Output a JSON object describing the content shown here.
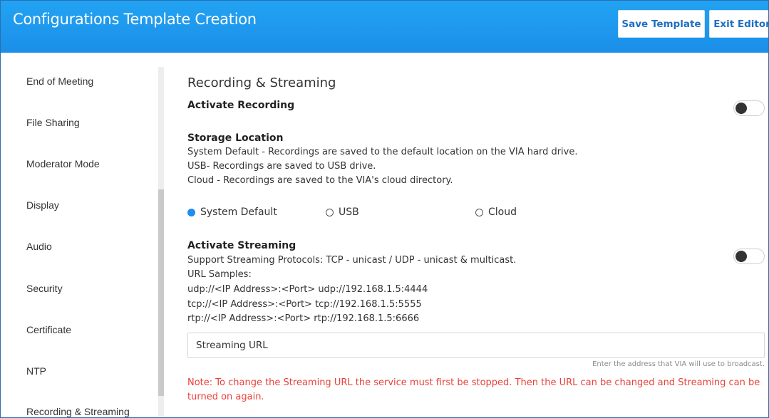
{
  "header": {
    "title": "Configurations Template Creation",
    "save_label": "Save Template",
    "exit_label": "Exit Editor"
  },
  "sidebar": {
    "items": [
      {
        "label": "End of Meeting"
      },
      {
        "label": "File Sharing"
      },
      {
        "label": "Moderator Mode"
      },
      {
        "label": "Display"
      },
      {
        "label": "Audio"
      },
      {
        "label": "Security"
      },
      {
        "label": "Certificate"
      },
      {
        "label": "NTP"
      },
      {
        "label": "Recording & Streaming"
      }
    ],
    "active_item": "Recording & Streaming"
  },
  "main": {
    "section_title": "Recording & Streaming",
    "recording": {
      "label": "Activate Recording",
      "enabled": false
    },
    "storage": {
      "title": "Storage Location",
      "lines": [
        "System Default - Recordings are saved to the default location on the VIA hard drive.",
        "USB- Recordings are saved to USB drive.",
        "Cloud - Recordings are saved to the VIA's cloud directory."
      ],
      "options": [
        {
          "label": "System Default",
          "checked": true
        },
        {
          "label": "USB",
          "checked": false
        },
        {
          "label": "Cloud",
          "checked": false
        }
      ]
    },
    "streaming": {
      "label": "Activate Streaming",
      "enabled": false,
      "lines": [
        "Support Streaming Protocols: TCP - unicast / UDP - unicast & multicast.",
        "URL Samples:",
        "udp://<IP Address>:<Port>   udp://192.168.1.5:4444",
        "tcp://<IP Address>:<Port>   tcp://192.168.1.5:5555",
        "rtp://<IP Address>:<Port>   rtp://192.168.1.5:6666"
      ],
      "url_placeholder": "Streaming URL",
      "url_value": "",
      "hint": "Enter the address that VIA will use to broadcast.",
      "note": "Note: To change the Streaming URL the service must first be stopped. Then the URL can be changed and Streaming can be turned on again."
    }
  },
  "colors": {
    "header_bg": "#1b8fe8",
    "button_text": "#1f6fc5",
    "radio_checked": "#1e8cf0",
    "note_text": "#e8423a",
    "active_underline": "#f2c200"
  }
}
